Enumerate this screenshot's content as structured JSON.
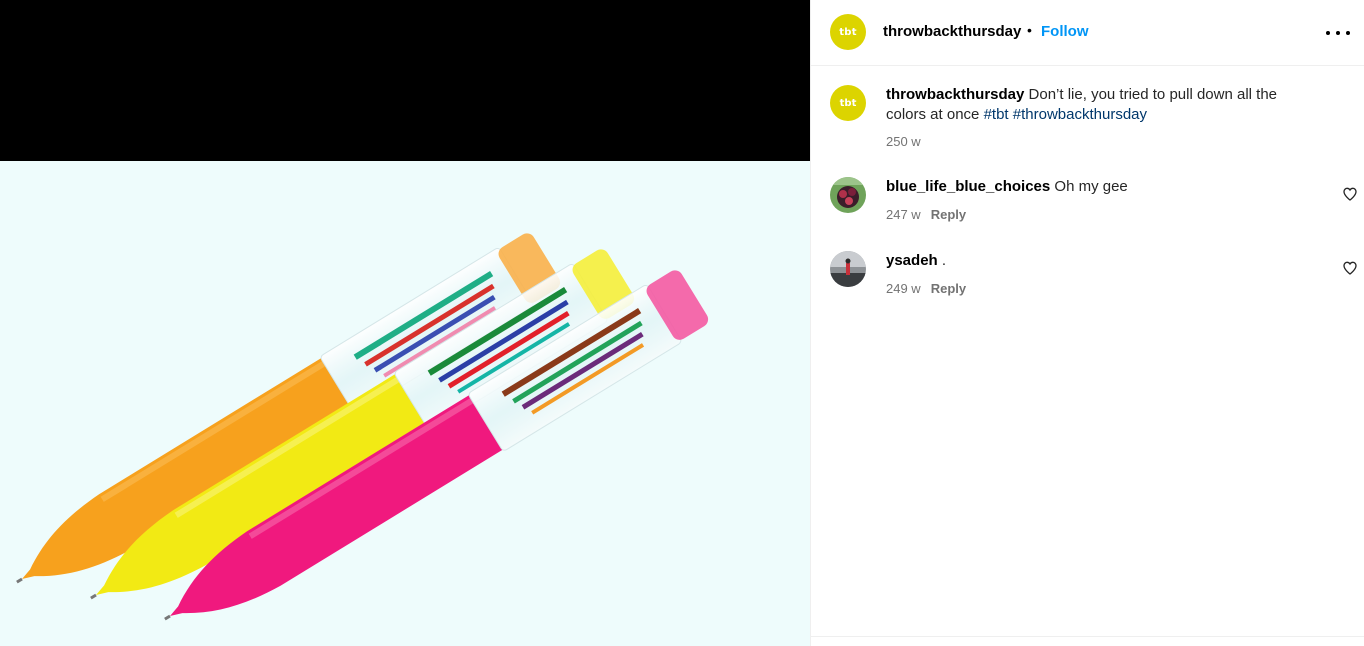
{
  "post": {
    "username": "throwbackthursday",
    "avatar_text": "tbt",
    "separator": "•",
    "follow_label": "Follow",
    "more_icon": "more-options-icon"
  },
  "caption": {
    "username": "throwbackthursday",
    "text": " Don’t lie, you tried to pull down all the colors at once ",
    "hashtags": [
      "#tbt",
      "#throwbackthursday"
    ],
    "time": "250 w"
  },
  "comments": [
    {
      "username": "blue_life_blue_choices",
      "text": " Oh my gee",
      "time": "247 w",
      "reply_label": "Reply",
      "like_icon": "heart-icon"
    },
    {
      "username": "ysadeh",
      "text": " .",
      "time": "249 w",
      "reply_label": "Reply",
      "like_icon": "heart-icon"
    }
  ],
  "media": {
    "background": "#eefcfc",
    "pen_colors": [
      "#f7a11d",
      "#f2ea14",
      "#f0197e"
    ]
  },
  "colors": {
    "accent": "#0095f6",
    "hashtag": "#00376b",
    "muted": "#737373"
  }
}
